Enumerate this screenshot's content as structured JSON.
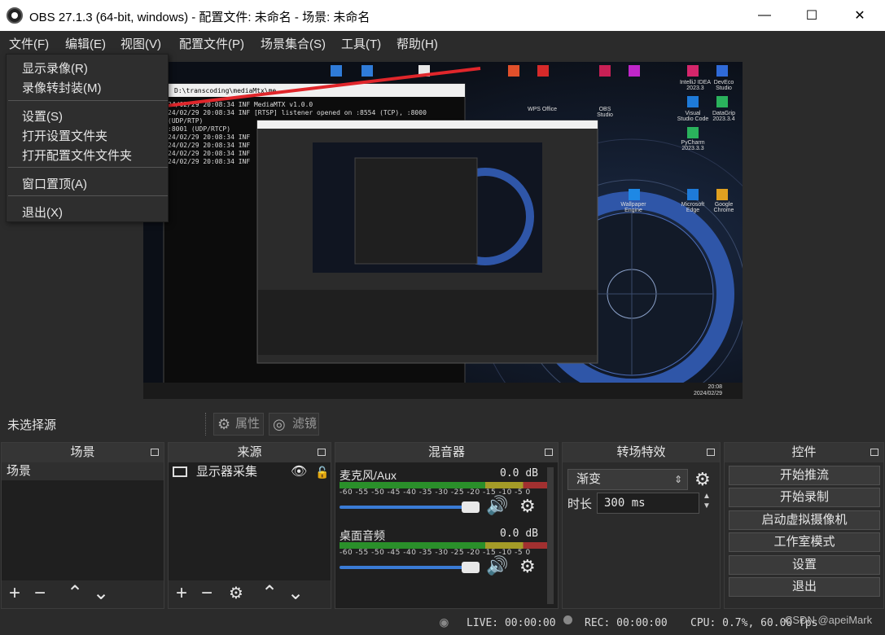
{
  "window": {
    "title": "OBS 27.1.3 (64-bit, windows) - 配置文件: 未命名 - 场景: 未命名",
    "minimize": "—",
    "maximize": "☐",
    "close": "✕"
  },
  "menu": [
    "文件(F)",
    "编辑(E)",
    "视图(V)",
    "配置文件(P)",
    "场景集合(S)",
    "工具(T)",
    "帮助(H)"
  ],
  "file_menu": {
    "items": [
      "显示录像(R)",
      "录像转封装(M)",
      "设置(S)",
      "打开设置文件夹",
      "打开配置文件文件夹",
      "窗口置顶(A)",
      "退出(X)"
    ]
  },
  "source_toolbar": {
    "no_source": "未选择源",
    "properties": "属性",
    "filters": "滤镜"
  },
  "scenes": {
    "title": "场景",
    "items": [
      "场景"
    ]
  },
  "sources": {
    "title": "来源",
    "items": [
      "显示器采集"
    ]
  },
  "mixer": {
    "title": "混音器",
    "channels": [
      {
        "name": "麦克风/Aux",
        "db": "0.0 dB"
      },
      {
        "name": "桌面音频",
        "db": "0.0 dB"
      }
    ],
    "scale": "-60 -55 -50 -45 -40 -35 -30 -25 -20 -15 -10 -5 0"
  },
  "transitions": {
    "title": "转场特效",
    "type": "渐变",
    "duration_label": "时长",
    "duration_value": "300 ms"
  },
  "controls": {
    "title": "控件",
    "buttons": [
      "开始推流",
      "开始录制",
      "启动虚拟摄像机",
      "工作室模式",
      "设置",
      "退出"
    ]
  },
  "status": {
    "live": "LIVE: 00:00:00",
    "rec": "REC: 00:00:00",
    "cpu": "CPU: 0.7%, 60.00 fps",
    "watermark": "CSDN @apeiMark"
  },
  "preview_screen": {
    "terminal_title": "D:\\transcoding\\mediaMtx\\me",
    "terminal_lines": [
      "24/02/29 20:08:34 INF MediaMTX v1.0.0",
      "24/02/29 20:08:34 INF [RTSP] listener opened on :8554 (TCP), :8000 (UDP/RTP)",
      ":8001 (UDP/RTCP)",
      "24/02/29 20:08:34 INF",
      "24/02/29 20:08:34 INF",
      "24/02/29 20:08:34 INF",
      "24/02/29 20:08:34 INF"
    ],
    "desktop_icons": [
      "IntelliJ IDEA 2023.3",
      "DevEco Studio",
      "Visual Studio Code",
      "DataGrip 2023.3.4",
      "PyCharm 2023.3.3",
      "Microsoft Edge",
      "Google Chrome",
      "Wallpaper Engine",
      "OBS Studio",
      "WPS Office"
    ],
    "clock": "20:08\n2024/02/29"
  },
  "colors": {
    "bg": "#2b2b2b",
    "panel_body": "#1f1f1f",
    "accent": "#3a7bd5",
    "arrow": "#e0262b"
  }
}
